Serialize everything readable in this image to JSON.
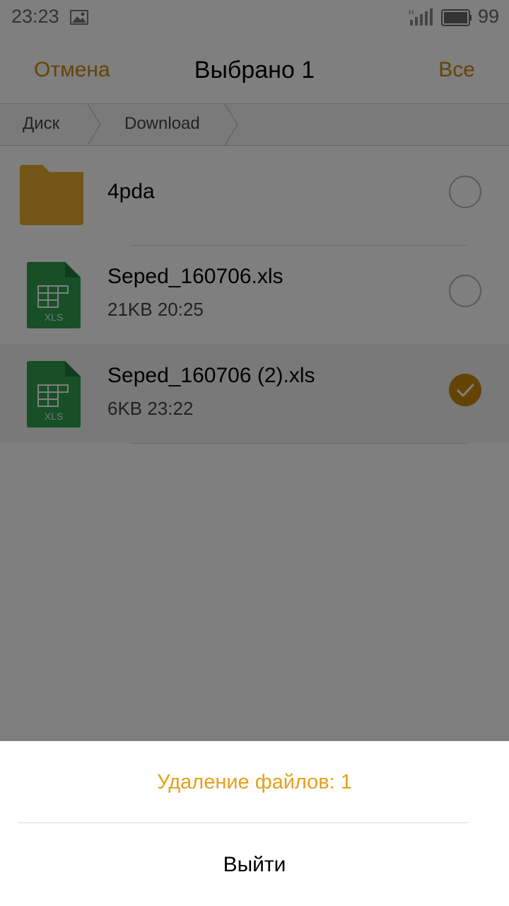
{
  "status_bar": {
    "time": "23:23",
    "network_label": "H",
    "battery_percent": "99",
    "icons": [
      "image-notification-icon",
      "signal-icon",
      "battery-icon"
    ]
  },
  "header": {
    "cancel_label": "Отмена",
    "title": "Выбрано 1",
    "select_all_label": "Все"
  },
  "breadcrumb": {
    "items": [
      "Диск",
      "Download"
    ]
  },
  "files": [
    {
      "name": "4pda",
      "meta": "",
      "type": "folder",
      "selected": false
    },
    {
      "name": "Seped_160706.xls",
      "meta": "21KB  20:25",
      "type": "xls",
      "icon_label": "XLS",
      "selected": false
    },
    {
      "name": "Seped_160706 (2).xls",
      "meta": "6KB  23:22",
      "type": "xls",
      "icon_label": "XLS",
      "selected": true
    }
  ],
  "dialog": {
    "title": "Удаление файлов: 1",
    "exit_label": "Выйти"
  },
  "colors": {
    "accent": "#c8890a",
    "dialog_accent": "#e5a11b",
    "folder": "#e3ac2e",
    "xls": "#2e9e4f"
  }
}
